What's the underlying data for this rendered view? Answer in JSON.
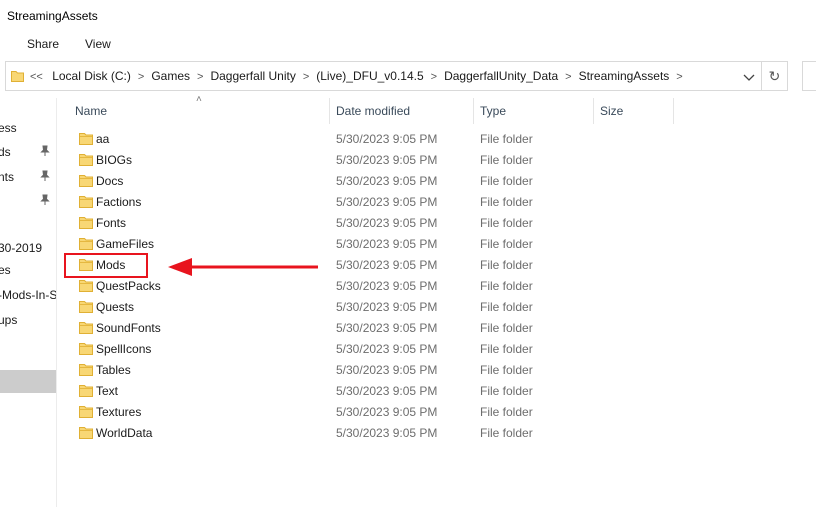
{
  "window": {
    "title": "StreamingAssets"
  },
  "ribbon": {
    "tabs": [
      "Share",
      "View"
    ]
  },
  "address": {
    "overflow_label": "<<",
    "crumbs": [
      "Local Disk (C:)",
      "Games",
      "Daggerfall Unity",
      "(Live)_DFU_v0.14.5",
      "DaggerfallUnity_Data",
      "StreamingAssets"
    ],
    "separator": ">"
  },
  "nav": {
    "items": [
      {
        "label": "ess",
        "pinned": false
      },
      {
        "label": "ds",
        "pinned": true
      },
      {
        "label": "nts",
        "pinned": true
      },
      {
        "label": "",
        "pinned": true
      },
      {
        "label": "30-2019",
        "pinned": false
      },
      {
        "label": "es",
        "pinned": false
      },
      {
        "label": "-Mods-In-S",
        "pinned": false
      },
      {
        "label": "ups",
        "pinned": false
      }
    ]
  },
  "columns": {
    "name": "Name",
    "date": "Date modified",
    "type": "Type",
    "size": "Size"
  },
  "files": [
    {
      "name": "aa",
      "date": "5/30/2023 9:05 PM",
      "type": "File folder"
    },
    {
      "name": "BIOGs",
      "date": "5/30/2023 9:05 PM",
      "type": "File folder"
    },
    {
      "name": "Docs",
      "date": "5/30/2023 9:05 PM",
      "type": "File folder"
    },
    {
      "name": "Factions",
      "date": "5/30/2023 9:05 PM",
      "type": "File folder"
    },
    {
      "name": "Fonts",
      "date": "5/30/2023 9:05 PM",
      "type": "File folder"
    },
    {
      "name": "GameFiles",
      "date": "5/30/2023 9:05 PM",
      "type": "File folder"
    },
    {
      "name": "Mods",
      "date": "5/30/2023 9:05 PM",
      "type": "File folder"
    },
    {
      "name": "QuestPacks",
      "date": "5/30/2023 9:05 PM",
      "type": "File folder"
    },
    {
      "name": "Quests",
      "date": "5/30/2023 9:05 PM",
      "type": "File folder"
    },
    {
      "name": "SoundFonts",
      "date": "5/30/2023 9:05 PM",
      "type": "File folder"
    },
    {
      "name": "SpellIcons",
      "date": "5/30/2023 9:05 PM",
      "type": "File folder"
    },
    {
      "name": "Tables",
      "date": "5/30/2023 9:05 PM",
      "type": "File folder"
    },
    {
      "name": "Text",
      "date": "5/30/2023 9:05 PM",
      "type": "File folder"
    },
    {
      "name": "Textures",
      "date": "5/30/2023 9:05 PM",
      "type": "File folder"
    },
    {
      "name": "WorldData",
      "date": "5/30/2023 9:05 PM",
      "type": "File folder"
    }
  ],
  "annotation": {
    "highlighted": "Mods",
    "color": "#e8141e"
  },
  "colors": {
    "folder_fill": "#f8d775",
    "folder_edge": "#e0b034",
    "annotation": "#e8141e"
  }
}
